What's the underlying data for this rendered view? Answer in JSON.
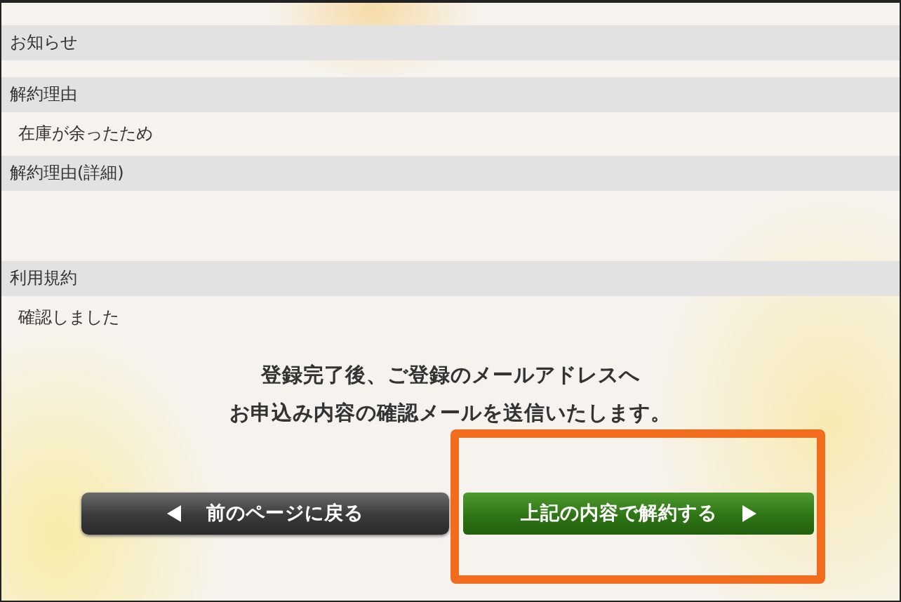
{
  "sections": [
    {
      "label": "お知らせ",
      "kind": "none"
    },
    {
      "label": "解約理由",
      "kind": "text",
      "value": "在庫が余ったため"
    },
    {
      "label": "解約理由(詳細)",
      "kind": "blank"
    },
    {
      "label": "利用規約",
      "kind": "text",
      "value": "確認しました"
    }
  ],
  "message": [
    "登録完了後、ご登録のメールアドレスへ",
    "お申込み内容の確認メールを送信いたします。"
  ],
  "buttons": [
    {
      "label": "前のページに戻る",
      "kind": "back",
      "highlighted": false
    },
    {
      "label": "上記の内容で解約する",
      "kind": "submit",
      "highlighted": true
    }
  ]
}
